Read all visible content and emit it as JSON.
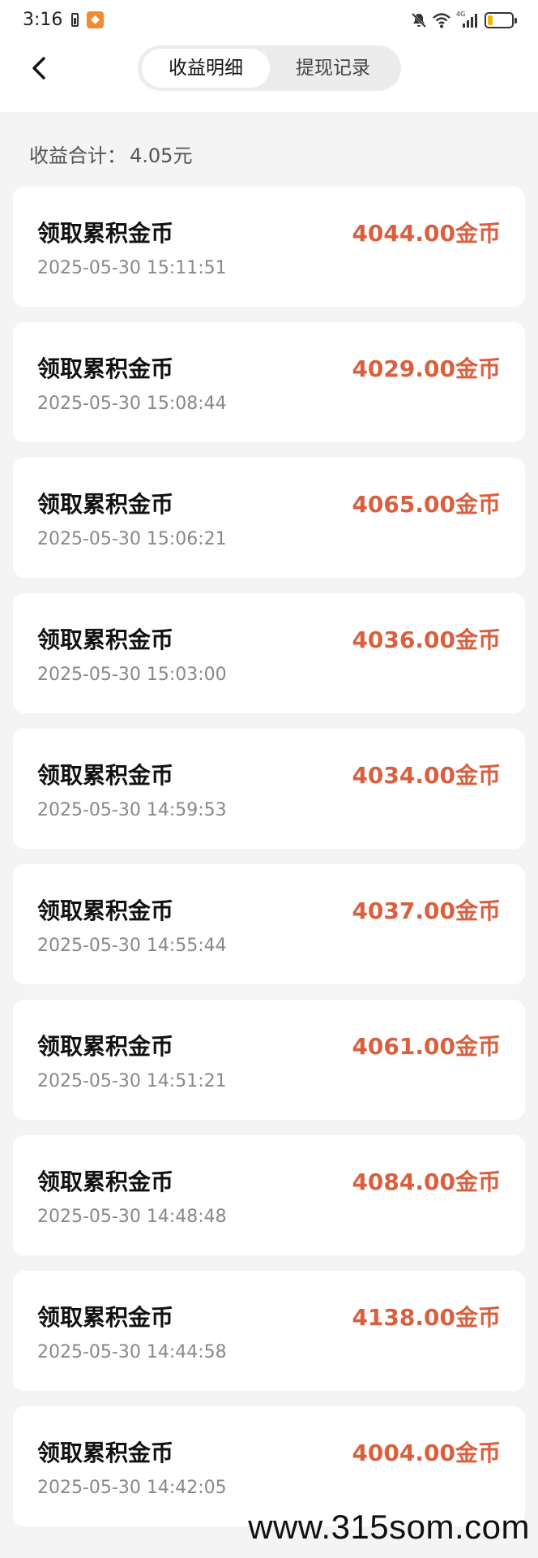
{
  "status_bar": {
    "time": "3:16",
    "app_icon": "app-notification-icon",
    "network": "4G"
  },
  "header": {
    "back_icon": "chevron-left-icon",
    "tabs": [
      {
        "label": "收益明细",
        "active": true
      },
      {
        "label": "提现记录",
        "active": false
      }
    ]
  },
  "summary": {
    "label": "收益合计：",
    "value": "4.05元"
  },
  "records": [
    {
      "title": "领取累积金币",
      "time": "2025-05-30 15:11:51",
      "amount": "4044.00金币"
    },
    {
      "title": "领取累积金币",
      "time": "2025-05-30 15:08:44",
      "amount": "4029.00金币"
    },
    {
      "title": "领取累积金币",
      "time": "2025-05-30 15:06:21",
      "amount": "4065.00金币"
    },
    {
      "title": "领取累积金币",
      "time": "2025-05-30 15:03:00",
      "amount": "4036.00金币"
    },
    {
      "title": "领取累积金币",
      "time": "2025-05-30 14:59:53",
      "amount": "4034.00金币"
    },
    {
      "title": "领取累积金币",
      "time": "2025-05-30 14:55:44",
      "amount": "4037.00金币"
    },
    {
      "title": "领取累积金币",
      "time": "2025-05-30 14:51:21",
      "amount": "4061.00金币"
    },
    {
      "title": "领取累积金币",
      "time": "2025-05-30 14:48:48",
      "amount": "4084.00金币"
    },
    {
      "title": "领取累积金币",
      "time": "2025-05-30 14:44:58",
      "amount": "4138.00金币"
    },
    {
      "title": "领取累积金币",
      "time": "2025-05-30 14:42:05",
      "amount": "4004.00金币"
    }
  ],
  "colors": {
    "amount": "#d95f3e",
    "background": "#f4f4f4"
  },
  "watermark": "www.315som.com"
}
